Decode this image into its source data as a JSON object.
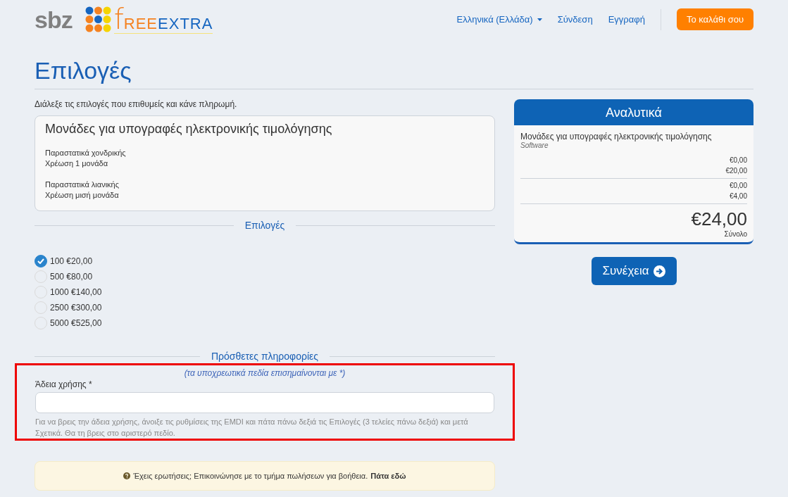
{
  "header": {
    "logo_sbz": "sbz",
    "logo_freeextra": {
      "initial": "f",
      "middle": "REE",
      "end": "EXTRA"
    },
    "nav": [
      {
        "label": "Ελληνικά (Ελλάδα)",
        "kind": "dropdown"
      },
      {
        "label": "Σύνδεση",
        "kind": "link"
      },
      {
        "label": "Εγγραφή",
        "kind": "link"
      }
    ],
    "cart_button": "Το καλάθι σου"
  },
  "page_title": "Επιλογές",
  "intro": "Διάλεξε τις επιλογές που επιθυμείς και κάνε πληρωμή.",
  "product_card": {
    "title": "Μονάδες για υπογραφές ηλεκτρονικής τιμολόγησης",
    "notes": [
      [
        "Παραστατικά χονδρικής",
        "Χρέωση 1 μονάδα"
      ],
      [
        "Παραστατικά λιανικής",
        "Χρέωση μισή μονάδα"
      ]
    ]
  },
  "options_heading": "Επιλογές",
  "options": [
    {
      "label": "100 €20,00",
      "selected": true
    },
    {
      "label": "500 €80,00",
      "selected": false
    },
    {
      "label": "1000 €140,00",
      "selected": false
    },
    {
      "label": "2500 €300,00",
      "selected": false
    },
    {
      "label": "5000 €525,00",
      "selected": false
    }
  ],
  "extra_heading": "Πρόσθετες πληροφορίες",
  "required_note": "(τα υποχρεωτικά πεδία επισημαίνονται με *)",
  "license_field": {
    "label": "Άδεια χρήσης *",
    "help": "Για να βρεις την άδεια χρήσης, άνοιξε τις ρυθμίσεις της EMDI και πάτα πάνω δεξιά τις Επιλογές (3 τελείες πάνω δεξιά) και μετά Σχετικά. Θα τη βρεις στο αριστερό πεδίο."
  },
  "help_box": {
    "text": "Έχεις ερωτήσεις; Επικοινώνησε με το τμήμα πωλήσεων για βοήθεια.",
    "link": "Πάτα εδώ"
  },
  "summary": {
    "title": "Αναλυτικά",
    "item": "Μονάδες για υπογραφές ηλεκτρονικής τιμολόγησης",
    "category": "Software",
    "price_groups": [
      [
        "€0,00",
        "€20,00"
      ],
      [
        "€0,00",
        "€4,00"
      ]
    ],
    "total": "€24,00",
    "total_label": "Σύνολο"
  },
  "continue_button": "Συνέχεια"
}
